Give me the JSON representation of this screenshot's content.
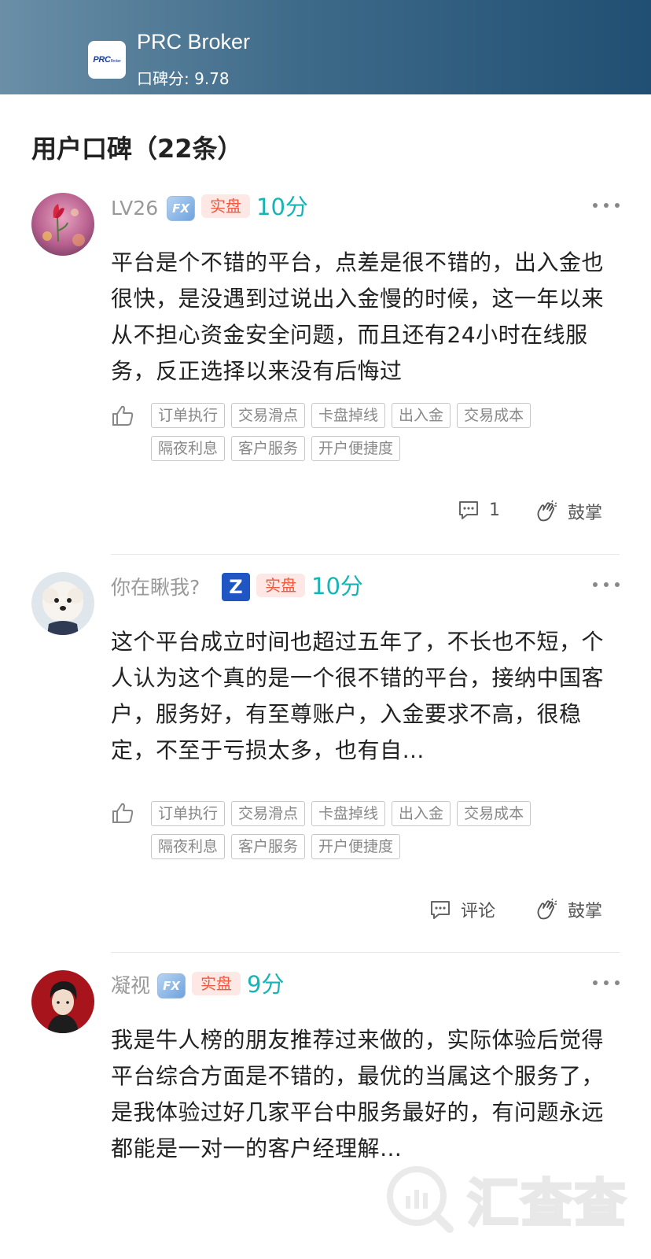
{
  "header": {
    "broker_name": "PRC Broker",
    "score_text": "口碑分: 9.78",
    "logo_text": "PRC",
    "logo_sub": "Broker"
  },
  "section": {
    "title": "用户口碑（22条）"
  },
  "reviews": [
    {
      "username": "LV26",
      "platform_badge": "FX",
      "account_tag": "实盘",
      "score": "10分",
      "content": "平台是个不错的平台，点差是很不错的，出入金也很快，是没遇到过说出入金慢的时候，这一年以来从不担心资金安全问题，而且还有24小时在线服务，反正选择以来没有后悔过",
      "tags": [
        "订单执行",
        "交易滑点",
        "卡盘掉线",
        "出入金",
        "交易成本",
        "隔夜利息",
        "客户服务",
        "开户便捷度"
      ],
      "comment_label": "1",
      "applause_label": "鼓掌"
    },
    {
      "username": "你在瞅我?",
      "platform_badge": "Z",
      "account_tag": "实盘",
      "score": "10分",
      "content": "这个平台成立时间也超过五年了，不长也不短，个人认为这个真的是一个很不错的平台，接纳中国客户，服务好，有至尊账户，入金要求不高，很稳定，不至于亏损太多，也有自…",
      "tags": [
        "订单执行",
        "交易滑点",
        "卡盘掉线",
        "出入金",
        "交易成本",
        "隔夜利息",
        "客户服务",
        "开户便捷度"
      ],
      "comment_label": "评论",
      "applause_label": "鼓掌"
    },
    {
      "username": "凝视",
      "platform_badge": "FX",
      "account_tag": "实盘",
      "score": "9分",
      "content": "我是牛人榜的朋友推荐过来做的，实际体验后觉得平台综合方面是不错的，最优的当属这个服务了，是我体验过好几家平台中服务最好的，有问题永远都能是一对一的客户经理解…"
    }
  ],
  "watermark": {
    "text": "汇查查"
  },
  "colors": {
    "header_start": "#6a8fa7",
    "header_end": "#204f73",
    "score": "#17b4b6",
    "tag_real": "#f0593f"
  }
}
